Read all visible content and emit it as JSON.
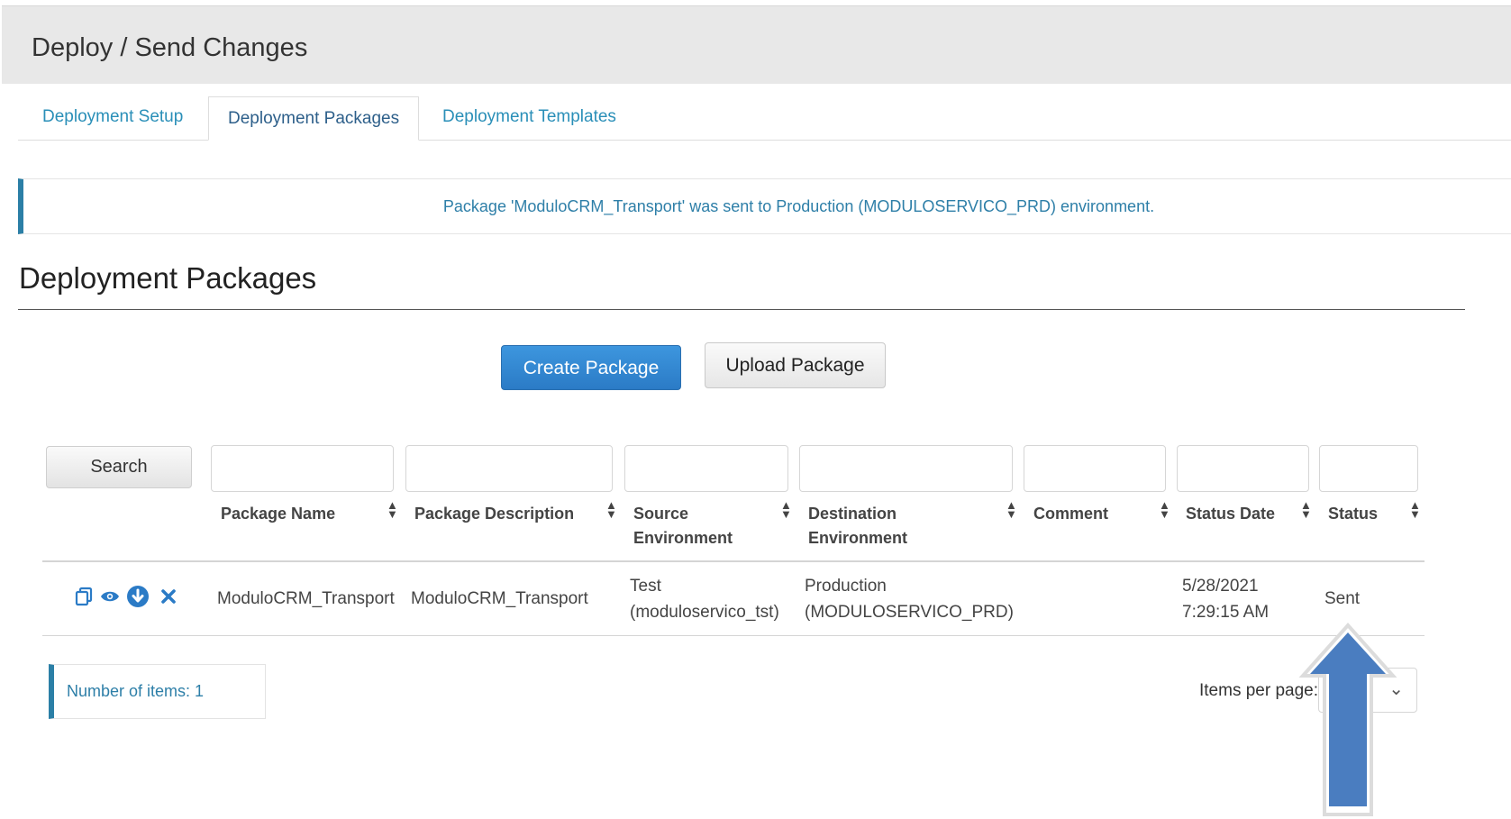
{
  "header": {
    "title": "Deploy / Send Changes"
  },
  "tabs": [
    {
      "label": "Deployment Setup",
      "active": false
    },
    {
      "label": "Deployment Packages",
      "active": true
    },
    {
      "label": "Deployment Templates",
      "active": false
    }
  ],
  "alert": {
    "message": "Package 'ModuloCRM_Transport' was sent to Production (MODULOSERVICO_PRD) environment."
  },
  "section": {
    "title": "Deployment Packages"
  },
  "buttons": {
    "create": "Create Package",
    "upload": "Upload Package",
    "search": "Search"
  },
  "table": {
    "columns": [
      {
        "line1": "Package Name",
        "line2": ""
      },
      {
        "line1": "Package Description",
        "line2": ""
      },
      {
        "line1": "Source",
        "line2": "Environment"
      },
      {
        "line1": "Destination",
        "line2": "Environment"
      },
      {
        "line1": "Comment",
        "line2": ""
      },
      {
        "line1": "Status Date",
        "line2": ""
      },
      {
        "line1": "Status",
        "line2": ""
      }
    ],
    "rows": [
      {
        "package_name": "ModuloCRM_Transport",
        "package_description": "ModuloCRM_Transport",
        "source_line1": "Test",
        "source_line2": "(moduloservico_tst)",
        "destination_line1": "Production",
        "destination_line2": "(MODULOSERVICO_PRD)",
        "comment": "",
        "status_date_line1": "5/28/2021",
        "status_date_line2": "7:29:15 AM",
        "status": "Sent"
      }
    ]
  },
  "footer": {
    "count": "Number of items: 1",
    "items_per_page_label": "Items per page:"
  },
  "colors": {
    "accent": "#2b7fa6",
    "link": "#2a8fb8",
    "primary_button": "#2b7bc6",
    "arrow": "#4a7dc0"
  },
  "icons": [
    "copy-icon",
    "eye-icon",
    "download-icon",
    "delete-icon",
    "sort-icon",
    "chevron-down-icon",
    "arrow-up-annotation"
  ]
}
